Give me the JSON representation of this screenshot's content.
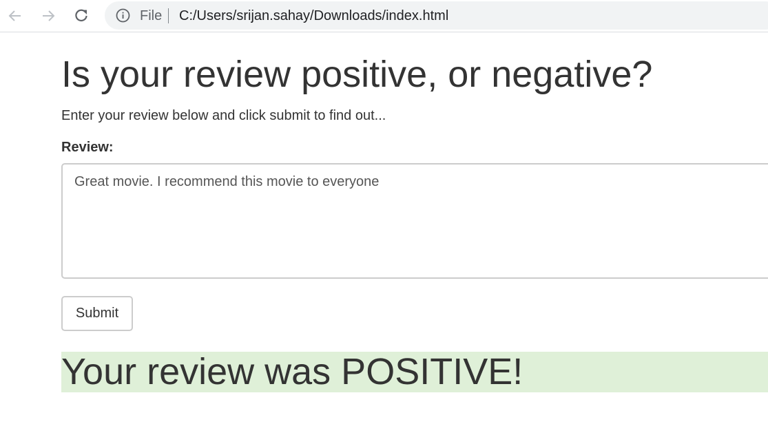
{
  "browser": {
    "scheme_label": "File",
    "url": "C:/Users/srijan.sahay/Downloads/index.html",
    "icons": {
      "back": "arrow-left-icon",
      "forward": "arrow-right-icon",
      "reload": "reload-icon",
      "info": "info-icon"
    }
  },
  "page": {
    "title": "Is your review positive, or negative?",
    "lead": "Enter your review below and click submit to find out...",
    "review_label": "Review:",
    "review_text": "Great movie. I recommend this movie to everyone",
    "submit_label": "Submit",
    "result_text": "Your review was POSITIVE!"
  },
  "colors": {
    "result_background": "#dff0d8",
    "text": "#333333",
    "border": "#cccccc"
  }
}
